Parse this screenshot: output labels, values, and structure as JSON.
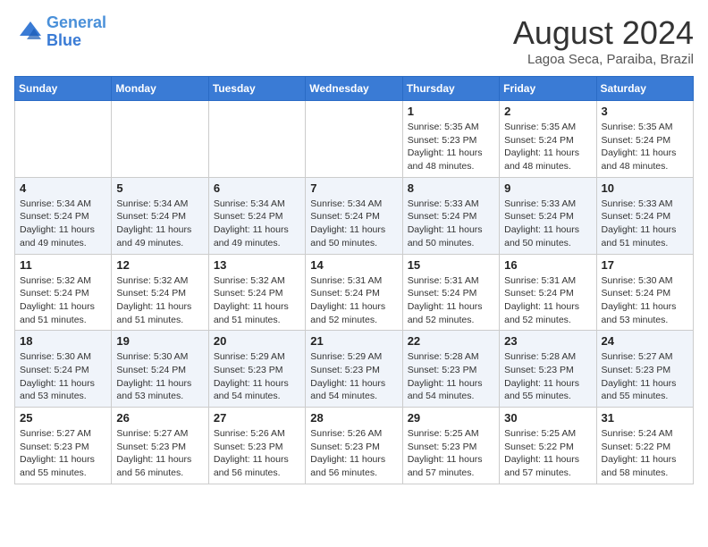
{
  "header": {
    "logo_line1": "General",
    "logo_line2": "Blue",
    "month": "August 2024",
    "location": "Lagoa Seca, Paraiba, Brazil"
  },
  "weekdays": [
    "Sunday",
    "Monday",
    "Tuesday",
    "Wednesday",
    "Thursday",
    "Friday",
    "Saturday"
  ],
  "weeks": [
    [
      {
        "day": "",
        "info": ""
      },
      {
        "day": "",
        "info": ""
      },
      {
        "day": "",
        "info": ""
      },
      {
        "day": "",
        "info": ""
      },
      {
        "day": "1",
        "info": "Sunrise: 5:35 AM\nSunset: 5:23 PM\nDaylight: 11 hours and 48 minutes."
      },
      {
        "day": "2",
        "info": "Sunrise: 5:35 AM\nSunset: 5:24 PM\nDaylight: 11 hours and 48 minutes."
      },
      {
        "day": "3",
        "info": "Sunrise: 5:35 AM\nSunset: 5:24 PM\nDaylight: 11 hours and 48 minutes."
      }
    ],
    [
      {
        "day": "4",
        "info": "Sunrise: 5:34 AM\nSunset: 5:24 PM\nDaylight: 11 hours and 49 minutes."
      },
      {
        "day": "5",
        "info": "Sunrise: 5:34 AM\nSunset: 5:24 PM\nDaylight: 11 hours and 49 minutes."
      },
      {
        "day": "6",
        "info": "Sunrise: 5:34 AM\nSunset: 5:24 PM\nDaylight: 11 hours and 49 minutes."
      },
      {
        "day": "7",
        "info": "Sunrise: 5:34 AM\nSunset: 5:24 PM\nDaylight: 11 hours and 50 minutes."
      },
      {
        "day": "8",
        "info": "Sunrise: 5:33 AM\nSunset: 5:24 PM\nDaylight: 11 hours and 50 minutes."
      },
      {
        "day": "9",
        "info": "Sunrise: 5:33 AM\nSunset: 5:24 PM\nDaylight: 11 hours and 50 minutes."
      },
      {
        "day": "10",
        "info": "Sunrise: 5:33 AM\nSunset: 5:24 PM\nDaylight: 11 hours and 51 minutes."
      }
    ],
    [
      {
        "day": "11",
        "info": "Sunrise: 5:32 AM\nSunset: 5:24 PM\nDaylight: 11 hours and 51 minutes."
      },
      {
        "day": "12",
        "info": "Sunrise: 5:32 AM\nSunset: 5:24 PM\nDaylight: 11 hours and 51 minutes."
      },
      {
        "day": "13",
        "info": "Sunrise: 5:32 AM\nSunset: 5:24 PM\nDaylight: 11 hours and 51 minutes."
      },
      {
        "day": "14",
        "info": "Sunrise: 5:31 AM\nSunset: 5:24 PM\nDaylight: 11 hours and 52 minutes."
      },
      {
        "day": "15",
        "info": "Sunrise: 5:31 AM\nSunset: 5:24 PM\nDaylight: 11 hours and 52 minutes."
      },
      {
        "day": "16",
        "info": "Sunrise: 5:31 AM\nSunset: 5:24 PM\nDaylight: 11 hours and 52 minutes."
      },
      {
        "day": "17",
        "info": "Sunrise: 5:30 AM\nSunset: 5:24 PM\nDaylight: 11 hours and 53 minutes."
      }
    ],
    [
      {
        "day": "18",
        "info": "Sunrise: 5:30 AM\nSunset: 5:24 PM\nDaylight: 11 hours and 53 minutes."
      },
      {
        "day": "19",
        "info": "Sunrise: 5:30 AM\nSunset: 5:24 PM\nDaylight: 11 hours and 53 minutes."
      },
      {
        "day": "20",
        "info": "Sunrise: 5:29 AM\nSunset: 5:23 PM\nDaylight: 11 hours and 54 minutes."
      },
      {
        "day": "21",
        "info": "Sunrise: 5:29 AM\nSunset: 5:23 PM\nDaylight: 11 hours and 54 minutes."
      },
      {
        "day": "22",
        "info": "Sunrise: 5:28 AM\nSunset: 5:23 PM\nDaylight: 11 hours and 54 minutes."
      },
      {
        "day": "23",
        "info": "Sunrise: 5:28 AM\nSunset: 5:23 PM\nDaylight: 11 hours and 55 minutes."
      },
      {
        "day": "24",
        "info": "Sunrise: 5:27 AM\nSunset: 5:23 PM\nDaylight: 11 hours and 55 minutes."
      }
    ],
    [
      {
        "day": "25",
        "info": "Sunrise: 5:27 AM\nSunset: 5:23 PM\nDaylight: 11 hours and 55 minutes."
      },
      {
        "day": "26",
        "info": "Sunrise: 5:27 AM\nSunset: 5:23 PM\nDaylight: 11 hours and 56 minutes."
      },
      {
        "day": "27",
        "info": "Sunrise: 5:26 AM\nSunset: 5:23 PM\nDaylight: 11 hours and 56 minutes."
      },
      {
        "day": "28",
        "info": "Sunrise: 5:26 AM\nSunset: 5:23 PM\nDaylight: 11 hours and 56 minutes."
      },
      {
        "day": "29",
        "info": "Sunrise: 5:25 AM\nSunset: 5:23 PM\nDaylight: 11 hours and 57 minutes."
      },
      {
        "day": "30",
        "info": "Sunrise: 5:25 AM\nSunset: 5:22 PM\nDaylight: 11 hours and 57 minutes."
      },
      {
        "day": "31",
        "info": "Sunrise: 5:24 AM\nSunset: 5:22 PM\nDaylight: 11 hours and 58 minutes."
      }
    ]
  ]
}
